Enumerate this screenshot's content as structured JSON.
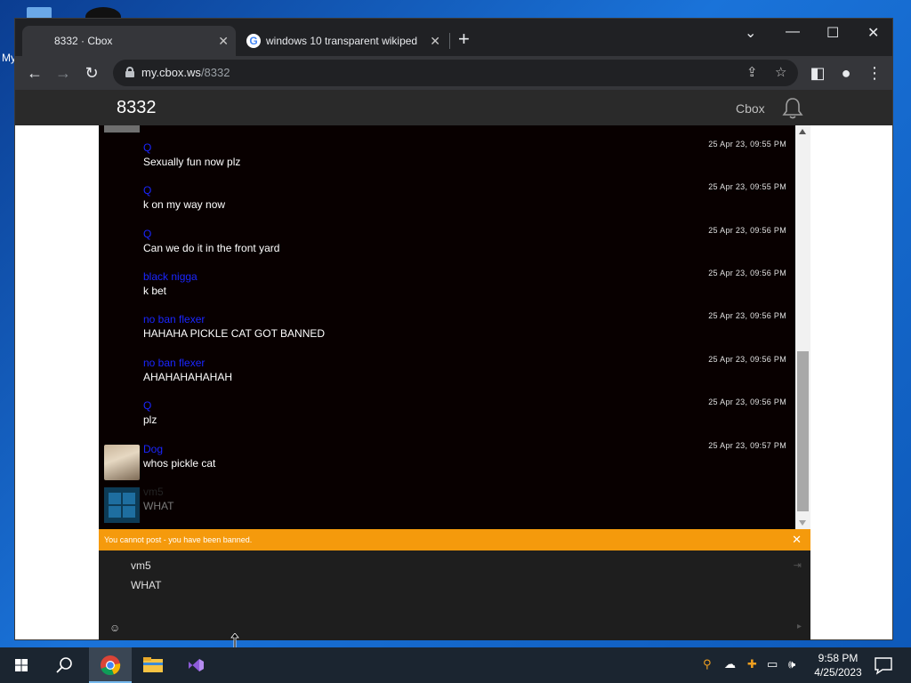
{
  "desktop": {
    "partial_label": "My"
  },
  "browser": {
    "tabs": [
      {
        "title": "8332 · Cbox",
        "active": true
      },
      {
        "title": "windows 10 transparent wikiped",
        "active": false
      }
    ],
    "url_host": "my.cbox.ws",
    "url_path": "/8332"
  },
  "site": {
    "title": "8332",
    "brand": "Cbox"
  },
  "messages": [
    {
      "name": "Q",
      "text": "Sexually fun now plz",
      "time": "25 Apr 23, 09:55 PM"
    },
    {
      "name": "Q",
      "text": "k on my way now",
      "time": "25 Apr 23, 09:55 PM"
    },
    {
      "name": "Q",
      "text": "Can we do it in the front yard",
      "time": "25 Apr 23, 09:56 PM"
    },
    {
      "name": "black nigga",
      "text": "k bet",
      "time": "25 Apr 23, 09:56 PM"
    },
    {
      "name": "no ban flexer",
      "text": "HAHAHA PICKLE CAT GOT BANNED",
      "time": "25 Apr 23, 09:56 PM"
    },
    {
      "name": "no ban flexer",
      "text": "AHAHAHAHAHAH",
      "time": "25 Apr 23, 09:56 PM"
    },
    {
      "name": "Q",
      "text": "plz",
      "time": "25 Apr 23, 09:56 PM"
    },
    {
      "name": "Dog",
      "text": "whos pickle cat",
      "time": "25 Apr 23, 09:57 PM"
    },
    {
      "name": "vm5",
      "text": "WHAT",
      "time": ""
    }
  ],
  "banned_notice": "You cannot post - you have been banned.",
  "compose": {
    "name_value": "vm5",
    "message_value": "WHAT",
    "emoji_icon": "☺"
  },
  "taskbar": {
    "time": "9:58 PM",
    "date": "4/25/2023"
  },
  "colors": {
    "username": "#1a26ff",
    "banned_bar": "#f59a0c",
    "chat_bg": "#080000"
  }
}
